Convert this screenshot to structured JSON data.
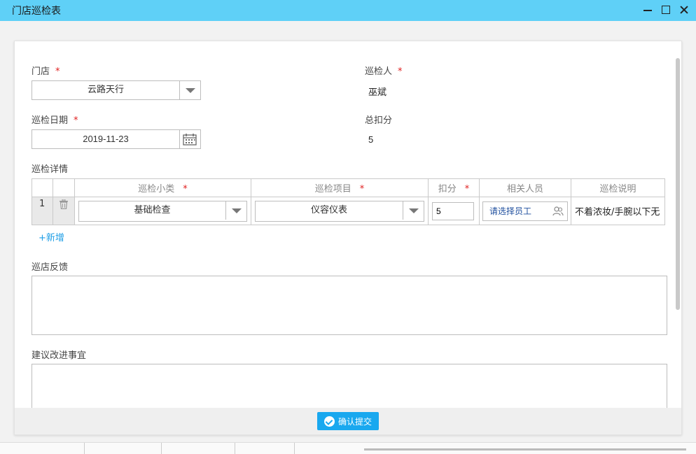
{
  "window": {
    "title": "门店巡检表"
  },
  "form": {
    "store": {
      "label": "门店",
      "required": "*",
      "value": "云路天行"
    },
    "inspector": {
      "label": "巡检人",
      "required": "*",
      "value": "巫斌"
    },
    "date": {
      "label": "巡检日期",
      "required": "*",
      "value": "2019-11-23"
    },
    "total": {
      "label": "总扣分",
      "value": "5"
    },
    "details": {
      "label": "巡检详情",
      "columns": {
        "subcategory": "巡检小类",
        "item": "巡检项目",
        "deduct": "扣分",
        "people": "相关人员",
        "note": "巡检说明"
      },
      "required": "*",
      "rows": [
        {
          "no": "1",
          "subcategory": "基础检查",
          "item": "仪容仪表",
          "deduct": "5",
          "people_placeholder": "请选择员工",
          "note": "不着浓妆/手腕以下无"
        }
      ],
      "add_label": "+新增"
    },
    "feedback": {
      "label": "巡店反馈",
      "value": ""
    },
    "suggestion": {
      "label": "建议改进事宜",
      "value": ""
    }
  },
  "footer": {
    "submit_label": "确认提交"
  },
  "icons": {
    "calendar": "calendar-icon",
    "trash": "trash-icon",
    "people": "people-icon",
    "check": "check-circle-icon"
  },
  "colors": {
    "titlebar": "#5fd0f7",
    "accent": "#19a8ef",
    "required": "#e02020",
    "link": "#1e9ee6"
  }
}
